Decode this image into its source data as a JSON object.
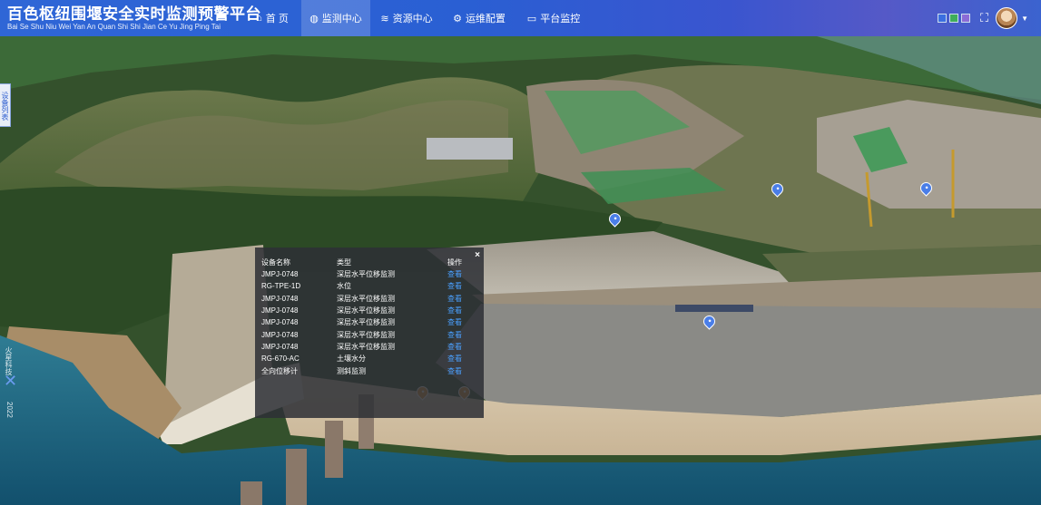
{
  "header": {
    "title": "百色枢纽围堰安全实时监测预警平台",
    "subtitle": "Bai Se Shu Niu Wei Yan An Quan Shi Shi Jian Ce Yu Jing Ping Tai",
    "nav": [
      {
        "label": "首 页",
        "icon": "home-icon"
      },
      {
        "label": "监测中心",
        "icon": "globe-icon",
        "active": true
      },
      {
        "label": "资源中心",
        "icon": "layers-icon"
      },
      {
        "label": "运维配置",
        "icon": "gear-icon"
      },
      {
        "label": "平台监控",
        "icon": "monitor-icon"
      }
    ],
    "theme_colors": [
      "#3b6fe0",
      "#3fae5a",
      "#8b6bd6"
    ],
    "accent": "#2f66d6"
  },
  "side_tab": {
    "label": "设备列表"
  },
  "watermark": {
    "text": "火星科技",
    "date": "2022"
  },
  "popup": {
    "columns": [
      "设备名称",
      "类型",
      "操作"
    ],
    "rows": [
      {
        "name": "JMPJ-0748",
        "type": "深层水平位移监测",
        "action": "查看"
      },
      {
        "name": "RG-TPE-1D",
        "type": "水位",
        "action": "查看"
      },
      {
        "name": "JMPJ-0748",
        "type": "深层水平位移监测",
        "action": "查看"
      },
      {
        "name": "JMPJ-0748",
        "type": "深层水平位移监测",
        "action": "查看"
      },
      {
        "name": "JMPJ-0748",
        "type": "深层水平位移监测",
        "action": "查看"
      },
      {
        "name": "JMPJ-0748",
        "type": "深层水平位移监测",
        "action": "查看"
      },
      {
        "name": "JMPJ-0748",
        "type": "深层水平位移监测",
        "action": "查看"
      },
      {
        "name": "RG-670-AC",
        "type": "土壤水分",
        "action": "查看"
      },
      {
        "name": "全向位移计",
        "type": "测斜监测",
        "action": "查看"
      }
    ],
    "close": "×",
    "link_color": "#4aa0ff"
  },
  "markers": [
    {
      "color": "blue"
    },
    {
      "color": "blue"
    },
    {
      "color": "blue"
    },
    {
      "color": "blue"
    },
    {
      "color": "orange"
    },
    {
      "color": "orange"
    }
  ]
}
